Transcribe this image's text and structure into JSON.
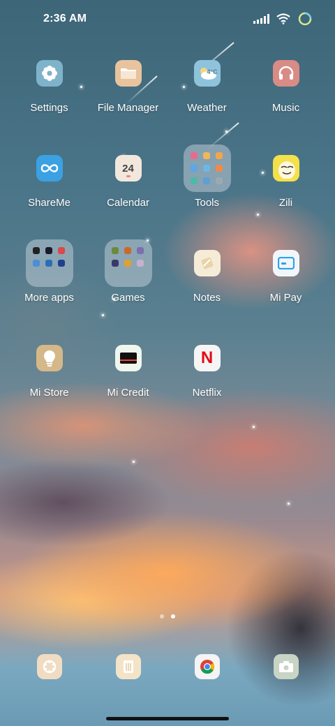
{
  "status_bar": {
    "time": "2:36 AM",
    "icons": [
      "signal-icon",
      "wifi-icon",
      "charging-ring-icon"
    ]
  },
  "apps": [
    {
      "label": "Settings",
      "icon": "settings-flower-icon",
      "color": "#7fb3c9"
    },
    {
      "label": "File Manager",
      "icon": "folder-icon",
      "color": "#e8c39d"
    },
    {
      "label": "Weather",
      "icon": "weather-icon",
      "color": "#8fc3dc",
      "badge": "4°C"
    },
    {
      "label": "Music",
      "icon": "headphones-icon",
      "color": "#d98b86"
    },
    {
      "label": "ShareMe",
      "icon": "infinity-icon",
      "color": "#3ba1e3"
    },
    {
      "label": "Calendar",
      "icon": "calendar-icon",
      "color": "#f2e7dc",
      "badge": "24"
    },
    {
      "label": "Tools",
      "icon": "folder-tools-icon",
      "folder": true
    },
    {
      "label": "Zili",
      "icon": "zili-face-icon",
      "color": "#f4e04a"
    },
    {
      "label": "More apps",
      "icon": "folder-more-apps-icon",
      "folder": true
    },
    {
      "label": "Games",
      "icon": "folder-games-icon",
      "folder": true
    },
    {
      "label": "Notes",
      "icon": "notes-icon",
      "color": "#f5ecd8"
    },
    {
      "label": "Mi Pay",
      "icon": "wallet-card-icon",
      "color": "#f1f6fa"
    },
    {
      "label": "Mi Store",
      "icon": "bulb-store-icon",
      "color": "#d5b889"
    },
    {
      "label": "Mi Credit",
      "icon": "credit-card-icon",
      "color": "#eef6ee"
    },
    {
      "label": "Netflix",
      "icon": "netflix-n-icon",
      "color": "#f5f5f5",
      "badge": "N"
    }
  ],
  "dock": [
    {
      "icon": "phone-dialer-icon",
      "color": "#f0dcc2"
    },
    {
      "icon": "messages-icon",
      "color": "#f3e4c8"
    },
    {
      "icon": "chrome-icon",
      "color": "#f4f4f4"
    },
    {
      "icon": "camera-icon",
      "color": "#c8d4c4"
    }
  ],
  "page_indicator": {
    "pages": 2,
    "current": 2
  },
  "colors": {
    "sky_top": "#3d6678",
    "sunset": "#ffaa5a",
    "text": "#ffffff"
  }
}
